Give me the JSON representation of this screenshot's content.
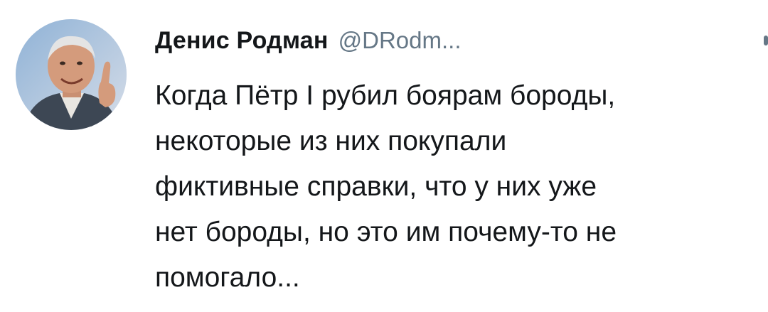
{
  "tweet": {
    "author": {
      "display_name": "Денис Родман",
      "handle": "@DRodm...",
      "avatar_icon": "user-avatar"
    },
    "text_lines": [
      "Когда Пётр I рубил боярам бороды,",
      "некоторые из них покупали",
      "фиктивные справки, что у них уже",
      "нет бороды, но это им почему-то не",
      "помогало..."
    ]
  },
  "colors": {
    "name": "#14171a",
    "handle": "#657786",
    "background": "#ffffff"
  }
}
